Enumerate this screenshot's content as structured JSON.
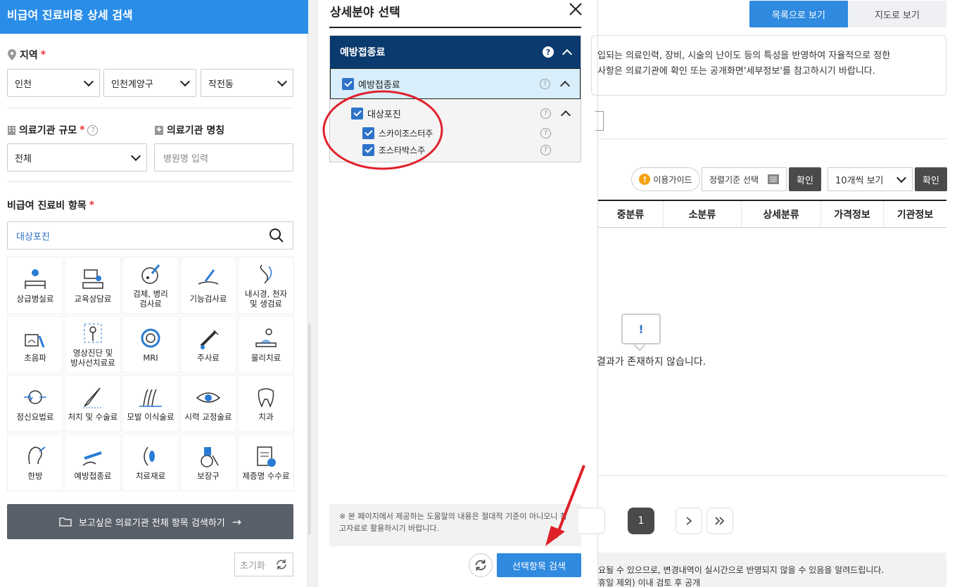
{
  "left": {
    "header": "비급여 진료비용 상세 검색",
    "region_label": "지역",
    "region_selects": [
      "인천",
      "인천계양구",
      "작전동"
    ],
    "scale_label": "의료기관 규모",
    "scale_value": "전체",
    "name_label": "의료기관 명칭",
    "name_placeholder": "병원명 입력",
    "item_label": "비급여 진료비 항목",
    "search_value": "대상포진",
    "categories": [
      {
        "label": "상급병실료",
        "icon": "hospital-bed-icon"
      },
      {
        "label": "교육상담료",
        "icon": "counseling-icon"
      },
      {
        "label": "검체, 병리\n검사료",
        "icon": "specimen-icon"
      },
      {
        "label": "기능검사료",
        "icon": "function-test-icon"
      },
      {
        "label": "내시경, 천자\n및 생검료",
        "icon": "endoscope-icon"
      },
      {
        "label": "초음파",
        "icon": "ultrasound-icon"
      },
      {
        "label": "영상진단 및\n방사선치료료",
        "icon": "radiology-icon"
      },
      {
        "label": "MRI",
        "icon": "mri-icon"
      },
      {
        "label": "주사료",
        "icon": "syringe-icon"
      },
      {
        "label": "물리치료",
        "icon": "physical-therapy-icon"
      },
      {
        "label": "정신요법료",
        "icon": "brain-icon"
      },
      {
        "label": "처치 및 수술료",
        "icon": "scalpel-icon"
      },
      {
        "label": "모발 이식술료",
        "icon": "hair-icon"
      },
      {
        "label": "시력 교정술료",
        "icon": "eye-icon"
      },
      {
        "label": "치과",
        "icon": "tooth-icon"
      },
      {
        "label": "한방",
        "icon": "ear-icon"
      },
      {
        "label": "예방접종료",
        "icon": "vaccine-icon"
      },
      {
        "label": "치료재료",
        "icon": "material-icon"
      },
      {
        "label": "보장구",
        "icon": "wheelchair-icon"
      },
      {
        "label": "제증명 수수료",
        "icon": "certificate-icon"
      }
    ],
    "all_button": "보고싶은 의료기관 전체 항목 검색하기",
    "reset": "초기화"
  },
  "modal": {
    "title": "상세분야 선택",
    "tree": {
      "l1": "예방접종료",
      "l2": "예방접종료",
      "l3": "대상포진",
      "l4": [
        "스카이조스터주",
        "조스타박스주"
      ]
    },
    "notice": "※ 본 페이지에서 제공하는 도움말의 내용은 절대적 기준이 아니오니 참고자료로 활용하시기 바랍니다.",
    "search_button": "선택항목 검색"
  },
  "right": {
    "view_list": "목록으로 보기",
    "view_map": "지도로 보기",
    "info_line1": "입되는 의료인력, 장비, 시술의 난이도 등의 특성을 반영하여 자율적으로 정한",
    "info_line2": "사항은 의료기관에 확인 또는 공개화면'세부정보'를 참고하시기 바랍니다.",
    "guide": "이용가이드",
    "sort_placeholder": "정렬기준 선택",
    "confirm": "확인",
    "count": "10개씩 보기",
    "columns": [
      "중분류",
      "소분류",
      "상세분류",
      "가격정보",
      "기관정보"
    ],
    "empty_mark": "!",
    "empty_text": "결과가 존재하지 않습니다.",
    "page": "1",
    "footer_line1": "요될 수 있으므로, 변경내역이 실시간으로 반영되지 않을 수 있음을 알려드립니다.",
    "footer_line2": "휴일 제외) 이내 검토 후 공개"
  },
  "colors": {
    "primary": "#2f8ae0",
    "navy": "#0b3a6e",
    "annotation": "#e0202a"
  }
}
